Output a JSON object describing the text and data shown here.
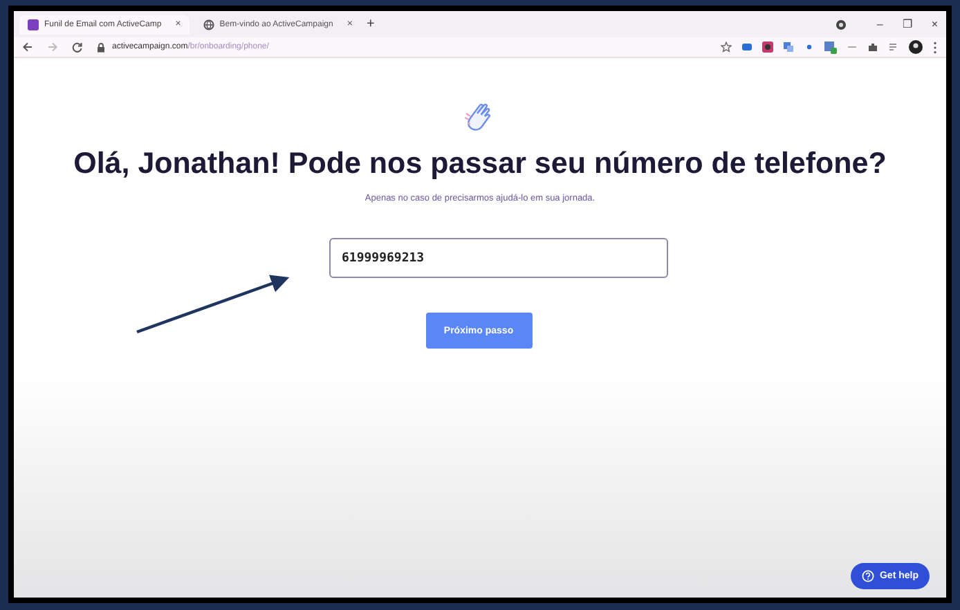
{
  "browser": {
    "tabs": [
      {
        "title": "Funil de Email com ActiveCamp",
        "close": "×",
        "selected": true
      },
      {
        "title": "Bem-vindo ao ActiveCampaign",
        "close": "×",
        "selected": false
      }
    ],
    "new_tab": "+",
    "window_controls": [
      "–",
      "❐",
      "×"
    ],
    "address": {
      "domain": "activecampaign.com",
      "path": "/br/onboarding/phone/"
    }
  },
  "page": {
    "heading": "Olá, Jonathan! Pode nos passar seu número de telefone?",
    "subtitle": "Apenas no caso de precisarmos ajudá-lo em sua jornada.",
    "phone_field": {
      "value": "61999969213"
    },
    "next_button": "Próximo passo",
    "help_button": "Get help"
  }
}
